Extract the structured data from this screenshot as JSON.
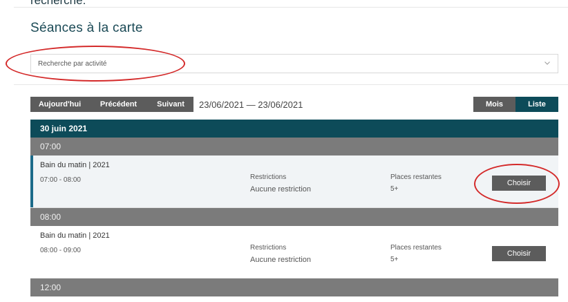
{
  "header": {
    "cut_off_text": "recherche.",
    "page_title": "Séances à la carte"
  },
  "search": {
    "placeholder": "Recherche par activité"
  },
  "toolbar": {
    "today": "Aujourd'hui",
    "previous": "Précédent",
    "next": "Suivant",
    "date_range": "23/06/2021 — 23/06/2021",
    "view_month": "Mois",
    "view_list": "Liste",
    "active_view": "Liste"
  },
  "schedule": {
    "day": "30 juin 2021",
    "hours": [
      "07:00",
      "08:00",
      "12:00"
    ],
    "sessions": [
      {
        "name": "Bain du matin | 2021",
        "time": "07:00 - 08:00",
        "restrictions_label": "Restrictions",
        "restrictions_value": "Aucune restriction",
        "places_label": "Places restantes",
        "places_value": "5+",
        "button": "Choisir",
        "active": true
      },
      {
        "name": "Bain du matin | 2021",
        "time": "08:00 - 09:00",
        "restrictions_label": "Restrictions",
        "restrictions_value": "Aucune restriction",
        "places_label": "Places restantes",
        "places_value": "5+",
        "button": "Choisir",
        "active": false
      }
    ]
  },
  "colors": {
    "brand_dark": "#0d4b59",
    "button_gray": "#5c5c5c",
    "hour_gray": "#7b7b7b",
    "accent_bar": "#1c6b8a",
    "annotation_red": "#d42a2a"
  }
}
